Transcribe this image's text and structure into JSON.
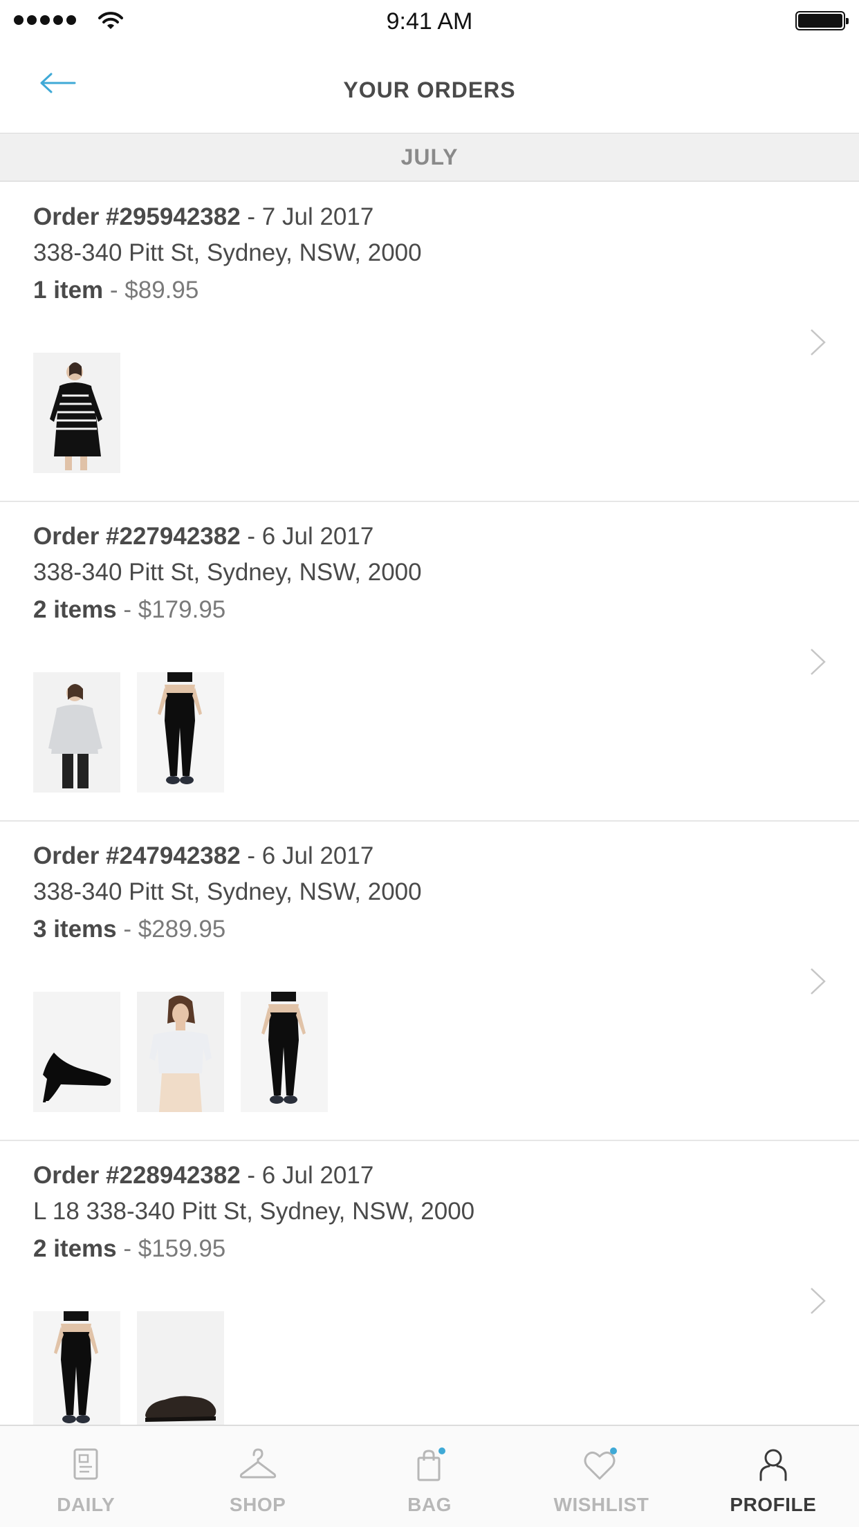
{
  "status_bar": {
    "time": "9:41 AM"
  },
  "nav": {
    "title": "YOUR ORDERS"
  },
  "section": {
    "month": "JULY"
  },
  "orders": [
    {
      "order_id": "Order #295942382",
      "date": " - 7 Jul 2017",
      "address": "338-340 Pitt St, Sydney, NSW, 2000",
      "items": "1 item",
      "price": " - $89.95",
      "thumbs": [
        "striped-dress",
        "",
        ""
      ]
    },
    {
      "order_id": "Order #227942382",
      "date": " - 6 Jul 2017",
      "address": "338-340 Pitt St, Sydney, NSW, 2000",
      "items": "2 items",
      "price": " - $179.95",
      "thumbs": [
        "grey-sweater",
        "black-leggings",
        ""
      ]
    },
    {
      "order_id": "Order #247942382",
      "date": " - 6 Jul 2017",
      "address": "338-340 Pitt St, Sydney, NSW, 2000",
      "items": "3 items",
      "price": " - $289.95",
      "thumbs": [
        "black-heel",
        "offshoulder-top",
        "black-leggings"
      ]
    },
    {
      "order_id": "Order #228942382",
      "date": " - 6 Jul 2017",
      "address": "L 18 338-340 Pitt St, Sydney, NSW, 2000",
      "items": "2 items",
      "price": " - $159.95",
      "thumbs": [
        "black-leggings",
        "brown-shoe",
        ""
      ]
    }
  ],
  "tabbar": {
    "tabs": [
      {
        "label": "DAILY",
        "icon": "newspaper-icon"
      },
      {
        "label": "SHOP",
        "icon": "hanger-icon"
      },
      {
        "label": "BAG",
        "icon": "bag-icon"
      },
      {
        "label": "WISHLIST",
        "icon": "heart-icon"
      },
      {
        "label": "PROFILE",
        "icon": "person-icon"
      }
    ],
    "active": "PROFILE",
    "accent_color": "#3fa9d6"
  }
}
